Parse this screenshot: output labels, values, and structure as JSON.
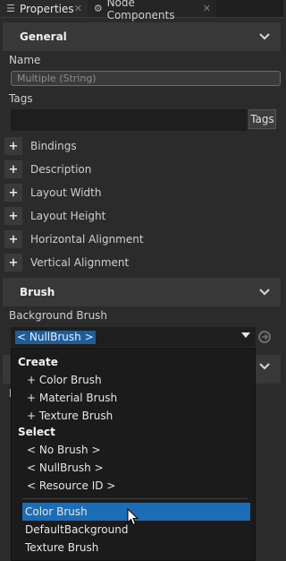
{
  "tabs": [
    {
      "label": "Properties",
      "icon": "properties-list-icon",
      "active": true
    },
    {
      "label": "Node Components",
      "icon": "node-components-icon",
      "active": false
    }
  ],
  "general": {
    "title": "General",
    "name_label": "Name",
    "name_placeholder": "Multiple (String)",
    "tags_label": "Tags",
    "tags_button": "Tags",
    "properties": [
      "Bindings",
      "Description",
      "Layout Width",
      "Layout Height",
      "Horizontal Alignment",
      "Vertical Alignment"
    ]
  },
  "brush": {
    "title": "Brush",
    "background_label": "Background Brush",
    "selected": "< NullBrush >",
    "obscured_label_start": "H"
  },
  "dropdown": {
    "create_header": "Create",
    "create_items": [
      "+ Color Brush",
      "+ Material Brush",
      "+ Texture Brush"
    ],
    "select_header": "Select",
    "select_items": [
      "< No Brush >",
      "< NullBrush >",
      "< Resource ID >"
    ],
    "resources": [
      "Color Brush",
      "DefaultBackground",
      "Texture Brush"
    ],
    "highlighted_index": 0
  },
  "colors": {
    "accent": "#1c6db5",
    "background": "#2b2b2b",
    "header": "#383838"
  }
}
